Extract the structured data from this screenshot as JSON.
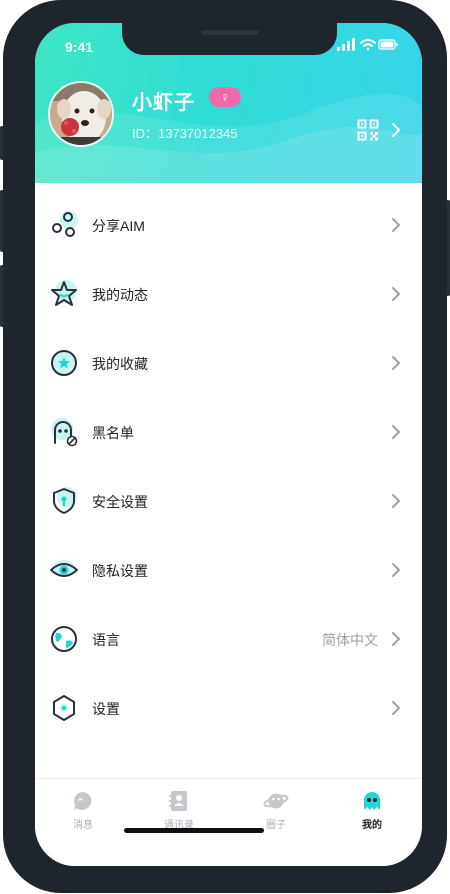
{
  "status": {
    "time": "9:41"
  },
  "profile": {
    "name": "小虾子",
    "gender_symbol": "♀",
    "id_text": "ID：13737012345"
  },
  "menu": [
    {
      "label": "分享AIM",
      "value": "",
      "icon": "share-icon"
    },
    {
      "label": "我的动态",
      "value": "",
      "icon": "star-icon"
    },
    {
      "label": "我的收藏",
      "value": "",
      "icon": "favorite-icon"
    },
    {
      "label": "黑名单",
      "value": "",
      "icon": "blacklist-icon"
    },
    {
      "label": "安全设置",
      "value": "",
      "icon": "shield-icon"
    },
    {
      "label": "隐私设置",
      "value": "",
      "icon": "eye-icon"
    },
    {
      "label": "语言",
      "value": "简体中文",
      "icon": "globe-icon"
    },
    {
      "label": "设置",
      "value": "",
      "icon": "settings-icon"
    }
  ],
  "tabs": [
    {
      "label": "消息",
      "icon": "message-icon",
      "active": false
    },
    {
      "label": "通讯录",
      "icon": "contacts-icon",
      "active": false
    },
    {
      "label": "圈子",
      "icon": "planet-icon",
      "active": false
    },
    {
      "label": "我的",
      "icon": "profile-icon",
      "active": true
    }
  ],
  "colors": {
    "accent": "#1ed8d0",
    "header_start": "#3ee6c2",
    "header_end": "#38d4ea",
    "badge": "#f06aa9",
    "icon_dark": "#2b3040"
  }
}
